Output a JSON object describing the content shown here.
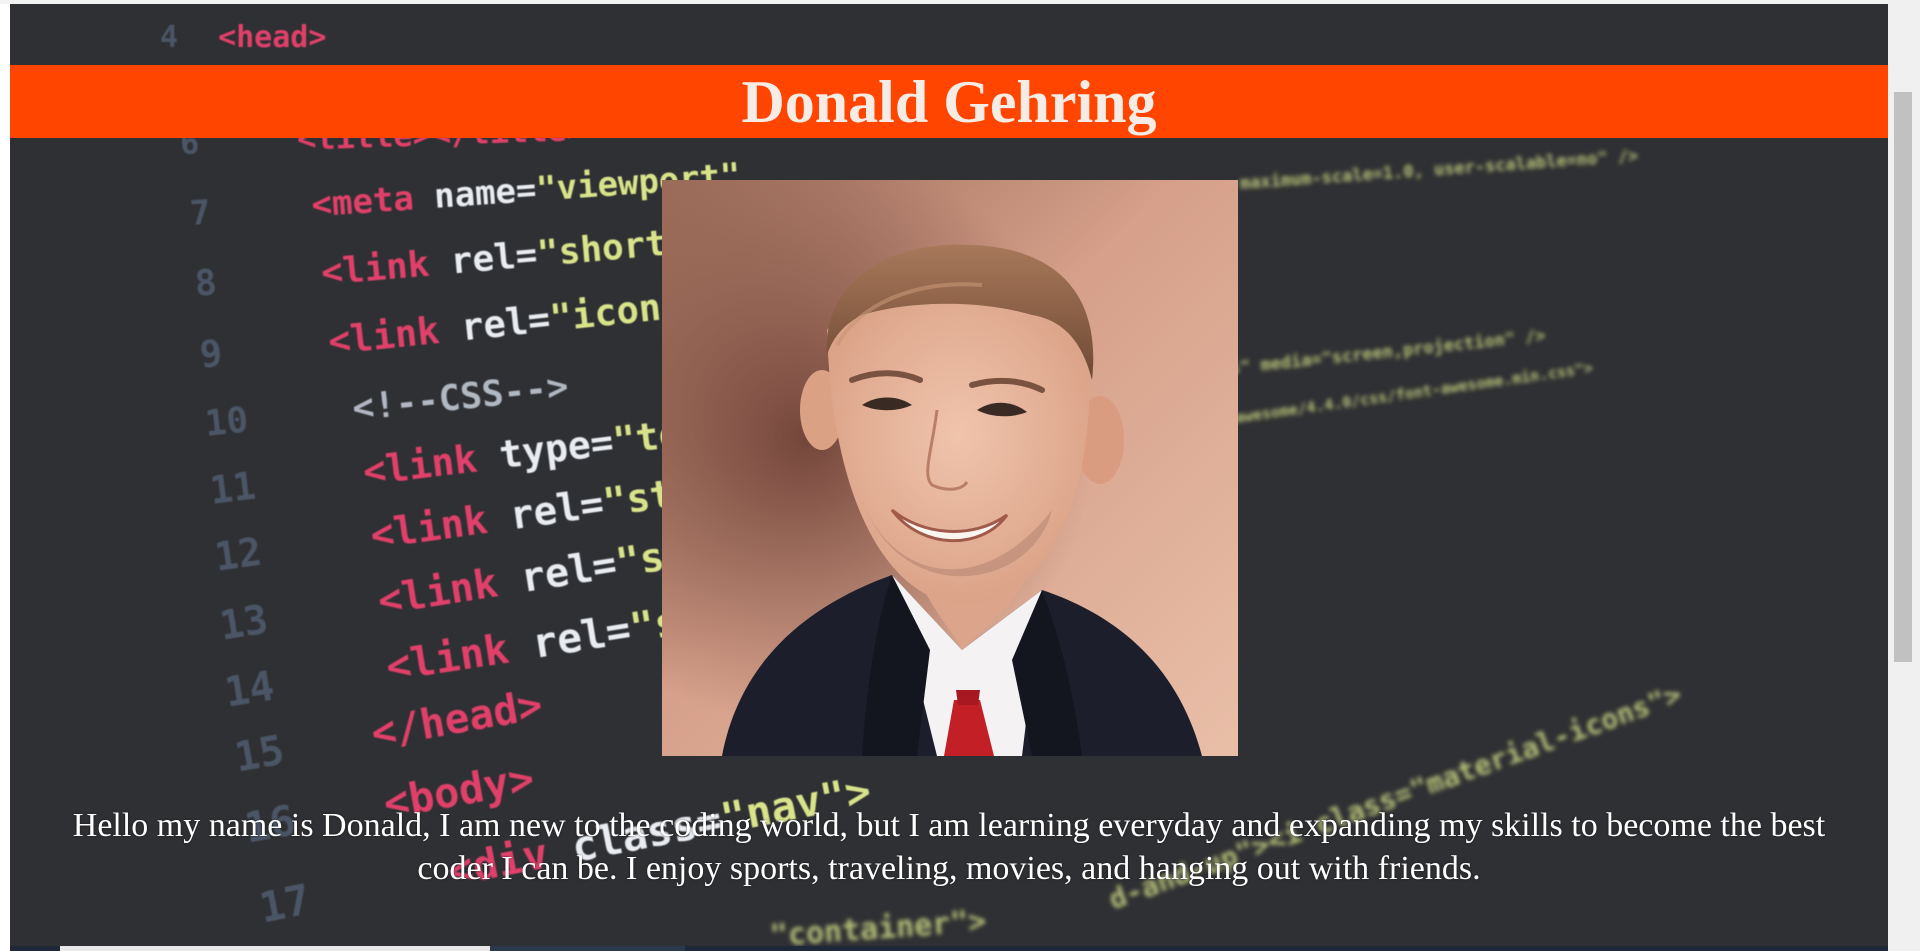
{
  "page": {
    "header_title": "Donald Gehring",
    "bio": "Hello my name is Donald, I am new to the coding world, but I am learning everyday and expanding my skills to become the best coder I can be. I enjoy sports, traveling, movies, and hanging out with friends.",
    "colors": {
      "header_bg": "#ff4500",
      "page_bg": "#2f3033",
      "header_text": "#f6ece6",
      "bio_text": "#ffffff"
    }
  },
  "background_code": {
    "lines": [
      {
        "num": "4",
        "tag": "<head>"
      },
      {
        "num": "6",
        "tag": "<title></title>"
      },
      {
        "num": "7",
        "tag": "<meta",
        "attr": "name=",
        "str": "\"viewport\""
      },
      {
        "num": "8",
        "tag": "<link",
        "attr": "rel=",
        "str": "\"shortcut i"
      },
      {
        "num": "9",
        "tag": "<link",
        "attr": "rel=",
        "str": "\"icon\" href"
      },
      {
        "num": "10",
        "tag": "<!--CSS-->"
      },
      {
        "num": "11",
        "tag": "<link",
        "attr": "type=",
        "str": "\"text/css"
      },
      {
        "num": "12",
        "tag": "<link",
        "attr": "rel=",
        "str": "\"styleshe"
      },
      {
        "num": "13",
        "tag": "<link",
        "attr": "rel=",
        "str": "\"styleshe"
      },
      {
        "num": "14",
        "tag": "<link",
        "attr": "rel=",
        "str": "\"stylesh"
      },
      {
        "num": "15",
        "tag": "</head>"
      },
      {
        "num": "16",
        "tag": "<body>"
      },
      {
        "num": "17",
        "tag": "<div",
        "attr": "class=",
        "str": "\"nav\">"
      }
    ],
    "right_fragments": [
      "maximum-scale=1.0, user-scalable=no\" />",
      "s\" media=\"screen,projection\" />",
      "awesome/4.4.0/css/font-awesome.min.css\">",
      "\"container\">",
      "d-and-up\"><i class=\"material-icons\">"
    ]
  }
}
